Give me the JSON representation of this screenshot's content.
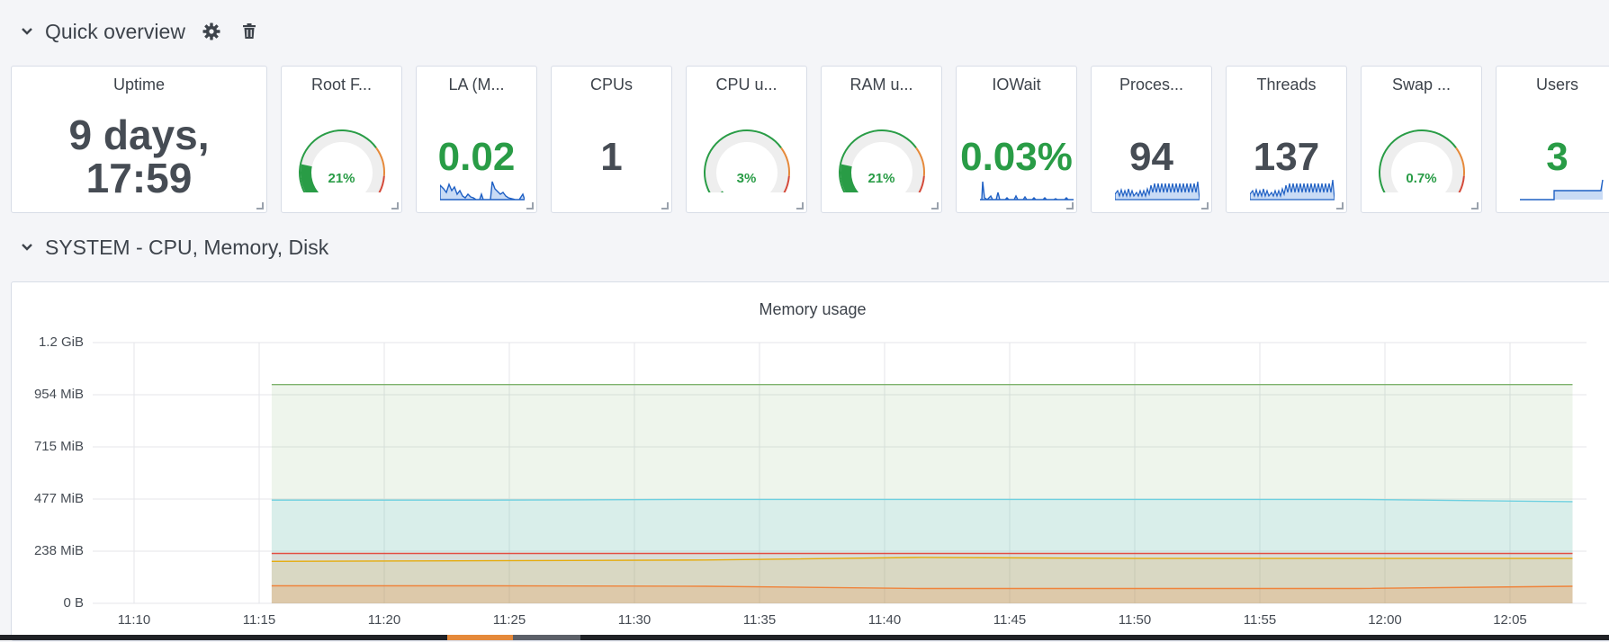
{
  "rows": [
    {
      "title": "Quick overview"
    },
    {
      "title": "SYSTEM - CPU, Memory, Disk"
    }
  ],
  "colors": {
    "green": "#299c46",
    "orange": "#e5893a",
    "red": "#d44a3a",
    "blue": "#1f60c4",
    "stat_dark": "#464c54"
  },
  "panels": [
    {
      "title": "Uptime",
      "value": "9 days, 17:59"
    },
    {
      "title": "Root F...",
      "gauge_percent": 21,
      "value": "21%"
    },
    {
      "title": "LA (M...",
      "value": "0.02"
    },
    {
      "title": "CPUs",
      "value": "1"
    },
    {
      "title": "CPU u...",
      "gauge_percent": 3,
      "value": "3%"
    },
    {
      "title": "RAM u...",
      "gauge_percent": 21,
      "value": "21%"
    },
    {
      "title": "IOWait",
      "value": "0.03%"
    },
    {
      "title": "Proces...",
      "value": "94"
    },
    {
      "title": "Threads",
      "value": "137"
    },
    {
      "title": "Swap ...",
      "gauge_percent": 0.7,
      "value": "0.7%"
    },
    {
      "title": "Users",
      "value": "3"
    }
  ],
  "chart_data": {
    "type": "area",
    "title": "Memory usage",
    "x": [
      "11:10",
      "11:15",
      "11:20",
      "11:25",
      "11:30",
      "11:35",
      "11:40",
      "11:45",
      "11:50",
      "11:55",
      "12:00",
      "12:05"
    ],
    "y_ticks": [
      "0 B",
      "238 MiB",
      "477 MiB",
      "715 MiB",
      "954 MiB",
      "1.2 GiB"
    ],
    "ylim_mib": [
      0,
      1192
    ],
    "legend": "none",
    "grid": true,
    "series": [
      {
        "color": "#7eb26d",
        "start": "11:15:30",
        "end": "12:07:30",
        "values_mib": [
          1000,
          1000
        ]
      },
      {
        "color": "#6ed0e0",
        "start": "11:15:30",
        "end": "12:07:30",
        "values_mib": [
          472,
          472,
          475,
          475,
          475,
          475,
          465
        ]
      },
      {
        "color": "#e24d42",
        "start": "11:15:30",
        "end": "12:07:30",
        "values_mib": [
          228,
          228,
          228,
          228,
          228,
          228,
          228
        ]
      },
      {
        "color": "#e5ac0e",
        "start": "11:15:30",
        "end": "12:07:30",
        "values_mib": [
          192,
          195,
          198,
          210,
          205,
          205,
          205
        ]
      },
      {
        "color": "#ef843c",
        "start": "11:15:30",
        "end": "12:07:30",
        "values_mib": [
          80,
          80,
          78,
          68,
          68,
          68,
          78
        ]
      }
    ]
  }
}
